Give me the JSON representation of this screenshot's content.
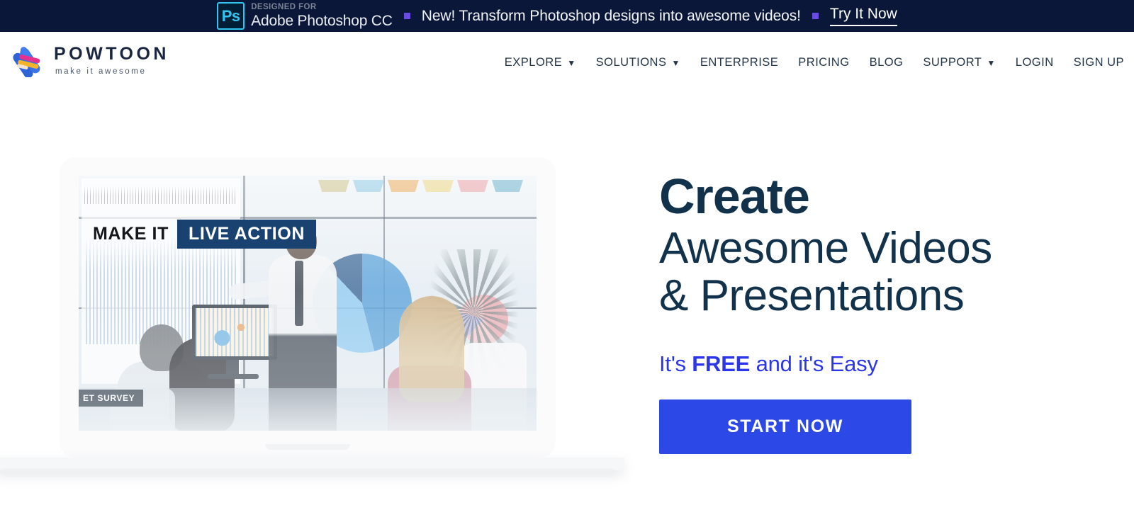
{
  "promo": {
    "ps_badge_text": "Ps",
    "designed_for": "DESIGNED FOR",
    "product": "Adobe Photoshop CC",
    "message": "New! Transform Photoshop designs into awesome videos!",
    "cta": "Try It Now",
    "background_color": "#0b1739",
    "bullet_color": "#6a4ce0",
    "badge_accent": "#31c5f0"
  },
  "header": {
    "brand_name": "POWTOON",
    "brand_tagline": "make it awesome",
    "nav": [
      {
        "label": "EXPLORE",
        "caret": "▼"
      },
      {
        "label": "SOLUTIONS",
        "caret": "▼"
      },
      {
        "label": "ENTERPRISE",
        "caret": ""
      },
      {
        "label": "PRICING",
        "caret": ""
      },
      {
        "label": "BLOG",
        "caret": ""
      },
      {
        "label": "SUPPORT",
        "caret": "▼"
      },
      {
        "label": "LOGIN",
        "caret": ""
      },
      {
        "label": "SIGN UP",
        "caret": ""
      }
    ]
  },
  "hero": {
    "headline_line1": "Create",
    "headline_line2": "Awesome Videos",
    "headline_line3": "& Presentations",
    "subhead_pre": "It's ",
    "subhead_strong": "FREE",
    "subhead_post": " and it's Easy",
    "cta_label": "START NOW",
    "headline_color": "#12314a",
    "subhead_color": "#2b36ea",
    "cta_color": "#2c49e8",
    "video": {
      "caption_plain": "MAKE IT",
      "caption_highlight": "LIVE ACTION",
      "caption_highlight_bg": "#1a4270",
      "survey_label": "ET SURVEY",
      "funnel_colors": [
        "#cbc08a",
        "#8cc6e2",
        "#e9a95c",
        "#e8d483",
        "#e79ea4",
        "#69b0cc"
      ]
    }
  }
}
